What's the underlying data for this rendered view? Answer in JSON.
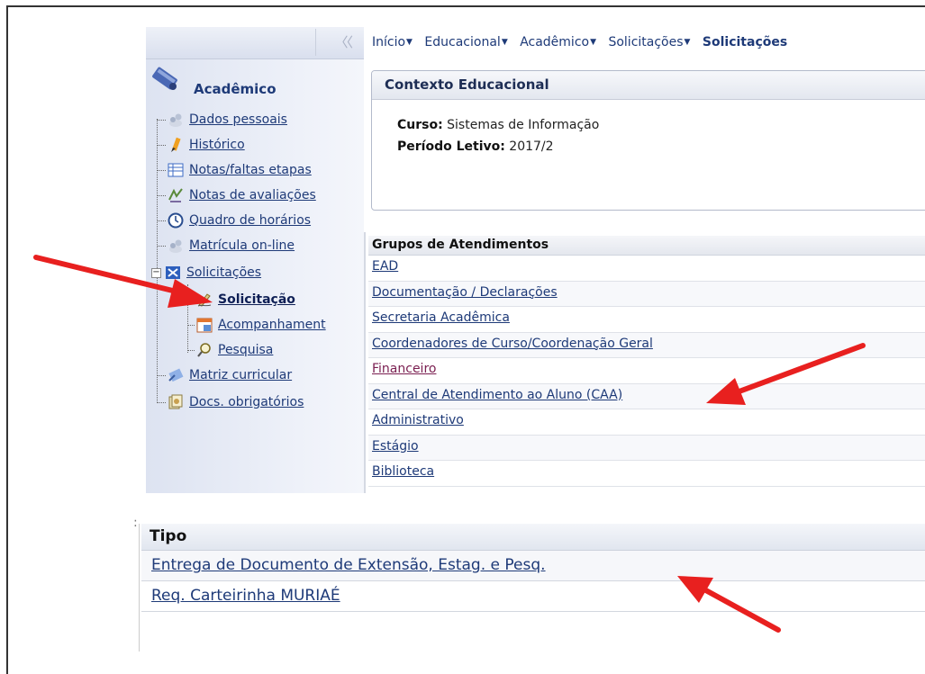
{
  "breadcrumb": {
    "items": [
      "Início",
      "Educacional",
      "Acadêmico",
      "Solicitações"
    ],
    "current": "Solicitações"
  },
  "sidebar": {
    "title": "Acadêmico",
    "items": [
      {
        "label": "Dados pessoais",
        "icon": "user-icon"
      },
      {
        "label": "Histórico",
        "icon": "pencil-icon"
      },
      {
        "label": "Notas/faltas etapas",
        "icon": "table-icon"
      },
      {
        "label": "Notas de avaliações",
        "icon": "grades-icon"
      },
      {
        "label": "Quadro de horários",
        "icon": "clock-icon"
      },
      {
        "label": "Matrícula on-line",
        "icon": "user-icon"
      },
      {
        "label": "Solicitações",
        "icon": "request-folder-icon"
      },
      {
        "label": "Solicitação",
        "icon": "pen-icon"
      },
      {
        "label": "Acompanhament",
        "icon": "calendar-icon"
      },
      {
        "label": "Pesquisa",
        "icon": "magnifier-icon"
      },
      {
        "label": "Matriz curricular",
        "icon": "curriculum-icon"
      },
      {
        "label": "Docs. obrigatórios",
        "icon": "documents-icon"
      }
    ]
  },
  "context": {
    "header": "Contexto Educacional",
    "curso_label": "Curso:",
    "curso_value": "Sistemas de Informação",
    "periodo_label": "Período Letivo:",
    "periodo_value": "2017/2"
  },
  "groups": {
    "header": "Grupos de Atendimentos",
    "items": [
      "EAD",
      "Documentação / Declarações",
      "Secretaria Acadêmica",
      "Coordenadores de Curso/Coordenação Geral",
      "Financeiro",
      "Central de Atendimento ao Aluno (CAA)",
      "Administrativo",
      "Estágio",
      "Biblioteca"
    ]
  },
  "tipo": {
    "separator": ":",
    "header": "Tipo",
    "items": [
      "Entrega de Documento de Extensão, Estag. e Pesq.",
      "Req. Carteirinha MURIAÉ"
    ]
  },
  "colors": {
    "link": "#1e3a78",
    "visited_link": "#7a1e50",
    "annotation_arrow": "#e8201f",
    "sidebar_bg": "#dde3f1"
  }
}
